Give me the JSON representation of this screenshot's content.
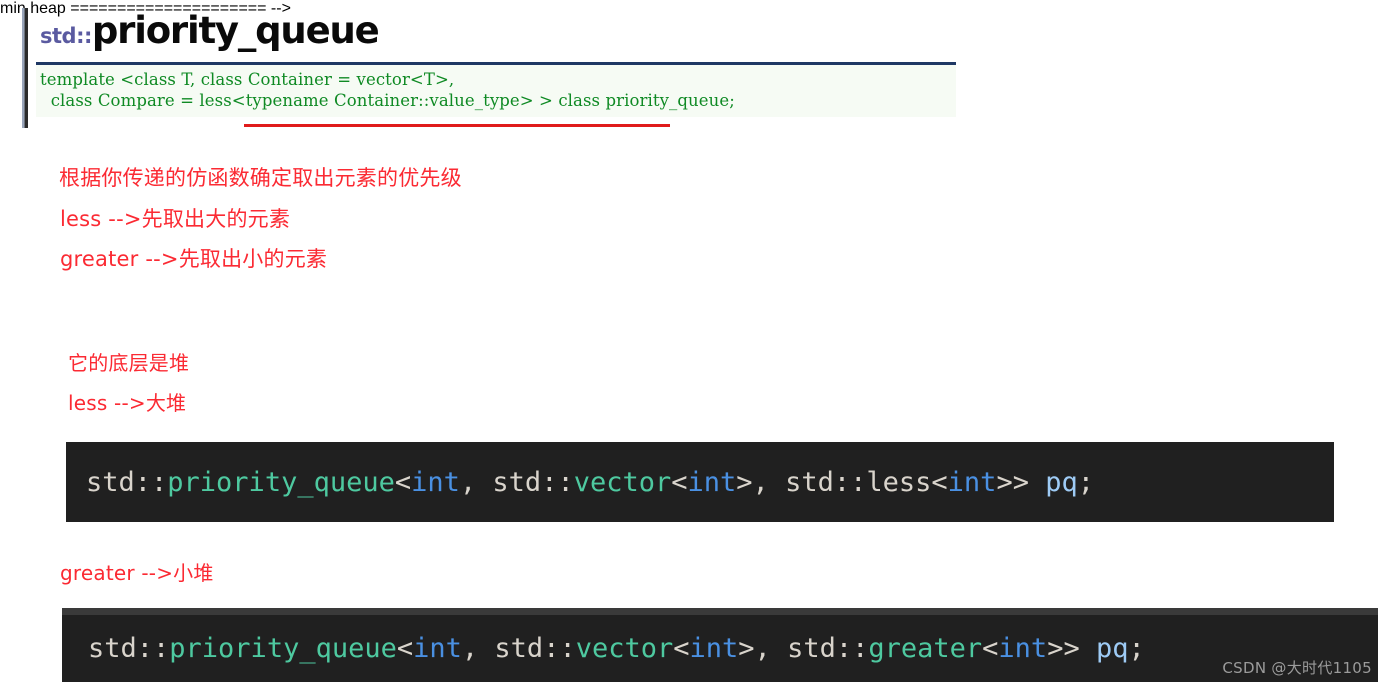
{
  "title": {
    "namespace": "std::",
    "name": "priority_queue"
  },
  "signature": {
    "line1": "template <class T, class Container = vector<T>,",
    "line2": "  class Compare = less<typename Container::value_type> > class priority_queue;",
    "underlined_fragment": "less<typename Container::value_type>"
  },
  "notes": {
    "note1": "根据你传递的仿函数确定取出元素的优先级",
    "note2": "less -->先取出大的元素",
    "note3": "greater -->先取出小的元素",
    "note4": "它的底层是堆",
    "note5": "less -->大堆",
    "note6": "greater -->小堆"
  },
  "code_blocks": [
    {
      "id": "less-example",
      "full_text": "std::priority_queue<int, std::vector<int>, std::less<int>> pq;",
      "tokens": [
        {
          "text": "std::",
          "kind": "plain"
        },
        {
          "text": "priority_queue",
          "kind": "type"
        },
        {
          "text": "<",
          "kind": "plain"
        },
        {
          "text": "int",
          "kind": "kw"
        },
        {
          "text": ", ",
          "kind": "plain"
        },
        {
          "text": "std::",
          "kind": "plain"
        },
        {
          "text": "vector",
          "kind": "type"
        },
        {
          "text": "<",
          "kind": "plain"
        },
        {
          "text": "int",
          "kind": "kw"
        },
        {
          "text": ">, ",
          "kind": "plain"
        },
        {
          "text": "std::less",
          "kind": "plain"
        },
        {
          "text": "<",
          "kind": "plain"
        },
        {
          "text": "int",
          "kind": "kw"
        },
        {
          "text": ">> ",
          "kind": "plain"
        },
        {
          "text": "pq",
          "kind": "var"
        },
        {
          "text": ";",
          "kind": "plain"
        }
      ]
    },
    {
      "id": "greater-example",
      "full_text": "std::priority_queue<int, std::vector<int>, std::greater<int>> pq;",
      "tokens": [
        {
          "text": "std::",
          "kind": "plain"
        },
        {
          "text": "priority_queue",
          "kind": "type"
        },
        {
          "text": "<",
          "kind": "plain"
        },
        {
          "text": "int",
          "kind": "kw"
        },
        {
          "text": ", ",
          "kind": "plain"
        },
        {
          "text": "std::",
          "kind": "plain"
        },
        {
          "text": "vector",
          "kind": "type"
        },
        {
          "text": "<",
          "kind": "plain"
        },
        {
          "text": "int",
          "kind": "kw"
        },
        {
          "text": ">, ",
          "kind": "plain"
        },
        {
          "text": "std::",
          "kind": "plain"
        },
        {
          "text": "greater",
          "kind": "type"
        },
        {
          "text": "<",
          "kind": "plain"
        },
        {
          "text": "int",
          "kind": "kw"
        },
        {
          "text": ">> ",
          "kind": "plain"
        },
        {
          "text": "pq",
          "kind": "var"
        },
        {
          "text": ";",
          "kind": "plain"
        }
      ]
    }
  ],
  "watermark": "CSDN @大时代1105",
  "colors": {
    "annotation_red": "#fb2a33",
    "signature_green": "#0f8a24",
    "underline_red": "#e01b1b",
    "title_namespace": "#5a5aa0",
    "rule_navy": "#1f3864",
    "code_bg": "#202020",
    "token_type": "#4ec9a0",
    "token_keyword": "#4a90e2",
    "token_plain": "#d9d4cc",
    "token_var": "#9ecbf5"
  }
}
